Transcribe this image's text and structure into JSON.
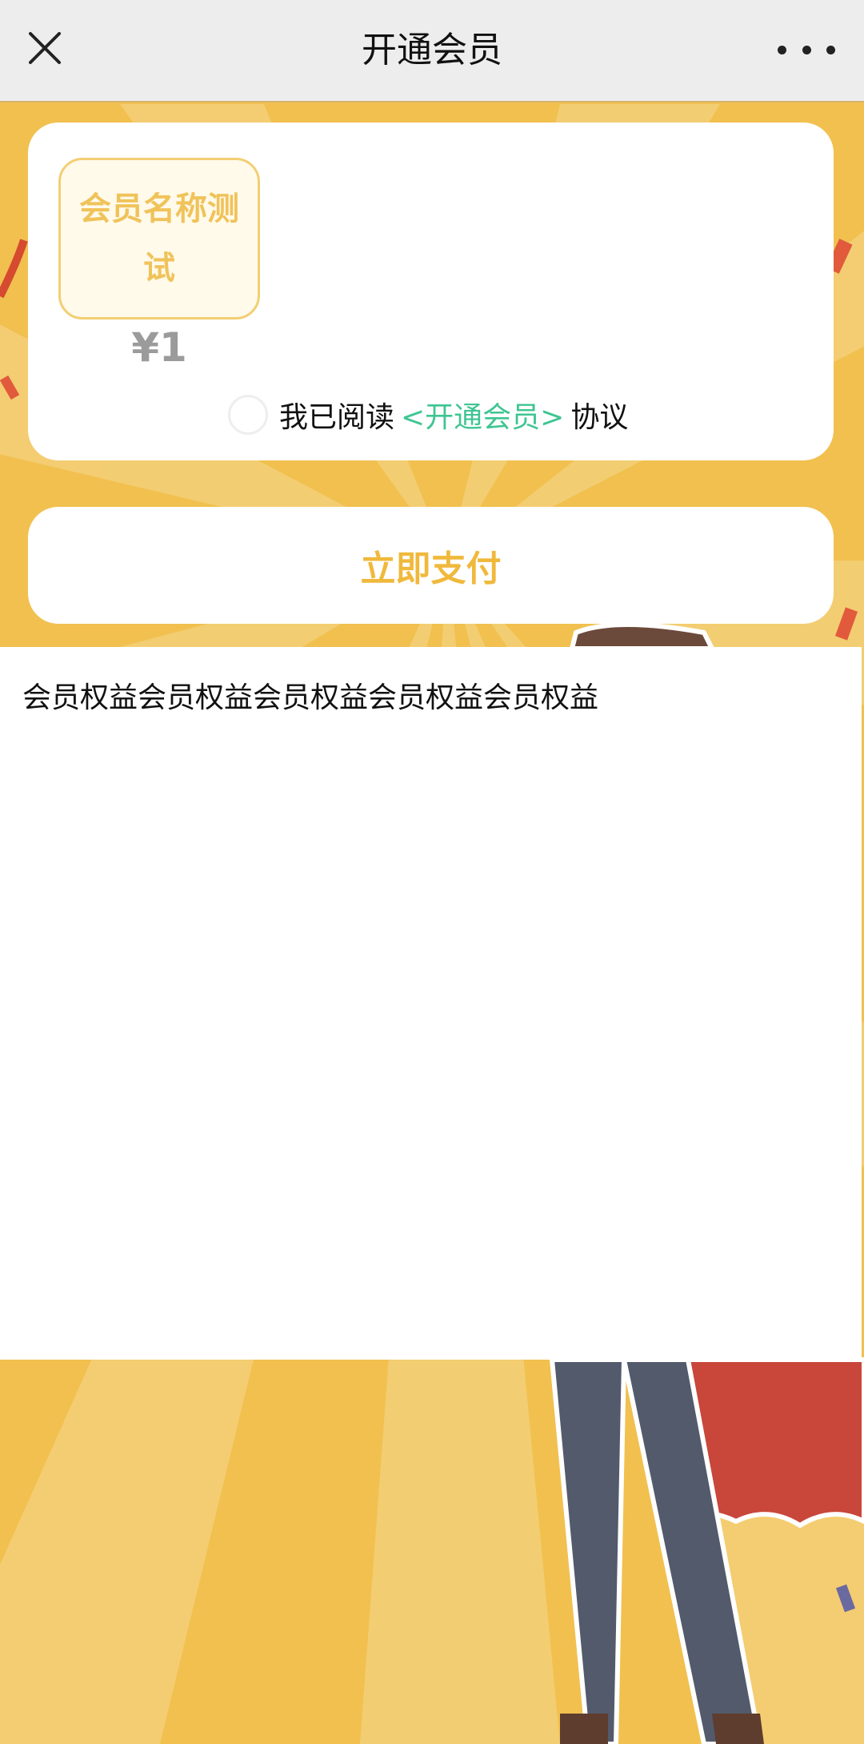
{
  "navbar": {
    "title": "开通会员",
    "close_icon": "close-icon",
    "more_icon": "more-dots-icon"
  },
  "plan": {
    "name": "会员名称测试",
    "price": "¥1"
  },
  "agreement": {
    "prefix": "我已阅读",
    "link": "<开通会员>",
    "suffix": "协议",
    "checked": false
  },
  "pay_button": {
    "label": "立即支付"
  },
  "benefits": {
    "text": "会员权益会员权益会员权益会员权益会员权益"
  },
  "colors": {
    "background": "#f1c04f",
    "accent": "#f0b93c",
    "link": "#3fc592",
    "price": "#9b9b9b"
  }
}
